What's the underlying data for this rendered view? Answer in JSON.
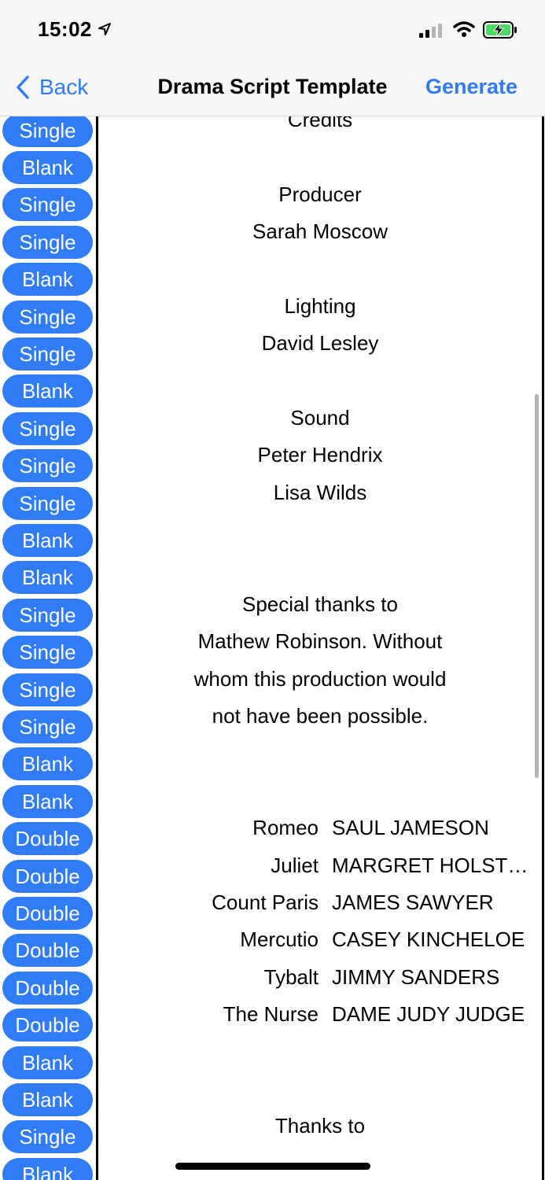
{
  "status_bar": {
    "time": "15:02"
  },
  "nav": {
    "back_label": "Back",
    "title": "Drama Script Template",
    "action_label": "Generate"
  },
  "line_types": [
    "Single",
    "Blank",
    "Single",
    "Single",
    "Blank",
    "Single",
    "Single",
    "Blank",
    "Single",
    "Single",
    "Single",
    "Blank",
    "Blank",
    "Single",
    "Single",
    "Single",
    "Single",
    "Blank",
    "Blank",
    "Double",
    "Double",
    "Double",
    "Double",
    "Double",
    "Double",
    "Blank",
    "Blank",
    "Single",
    "Blank"
  ],
  "script": {
    "credits": "Credits",
    "producer_heading": "Producer",
    "producer_name": "Sarah Moscow",
    "lighting_heading": "Lighting",
    "lighting_name": "David Lesley",
    "sound_heading": "Sound",
    "sound_name_1": "Peter Hendrix",
    "sound_name_2": "Lisa Wilds",
    "special_thanks": [
      "Special thanks to",
      "Mathew Robinson. Without",
      "whom this production would",
      "not have been possible."
    ],
    "cast": [
      {
        "role": "Romeo",
        "actor": "SAUL JAMESON"
      },
      {
        "role": "Juliet",
        "actor": "MARGRET HOLSTEIN"
      },
      {
        "role": "Count Paris",
        "actor": "JAMES SAWYER"
      },
      {
        "role": "Mercutio",
        "actor": "CASEY KINCHELOE"
      },
      {
        "role": "Tybalt",
        "actor": "JIMMY SANDERS"
      },
      {
        "role": "The Nurse",
        "actor": "DAME JUDY JUDGE"
      }
    ],
    "thanks_to": "Thanks to"
  }
}
